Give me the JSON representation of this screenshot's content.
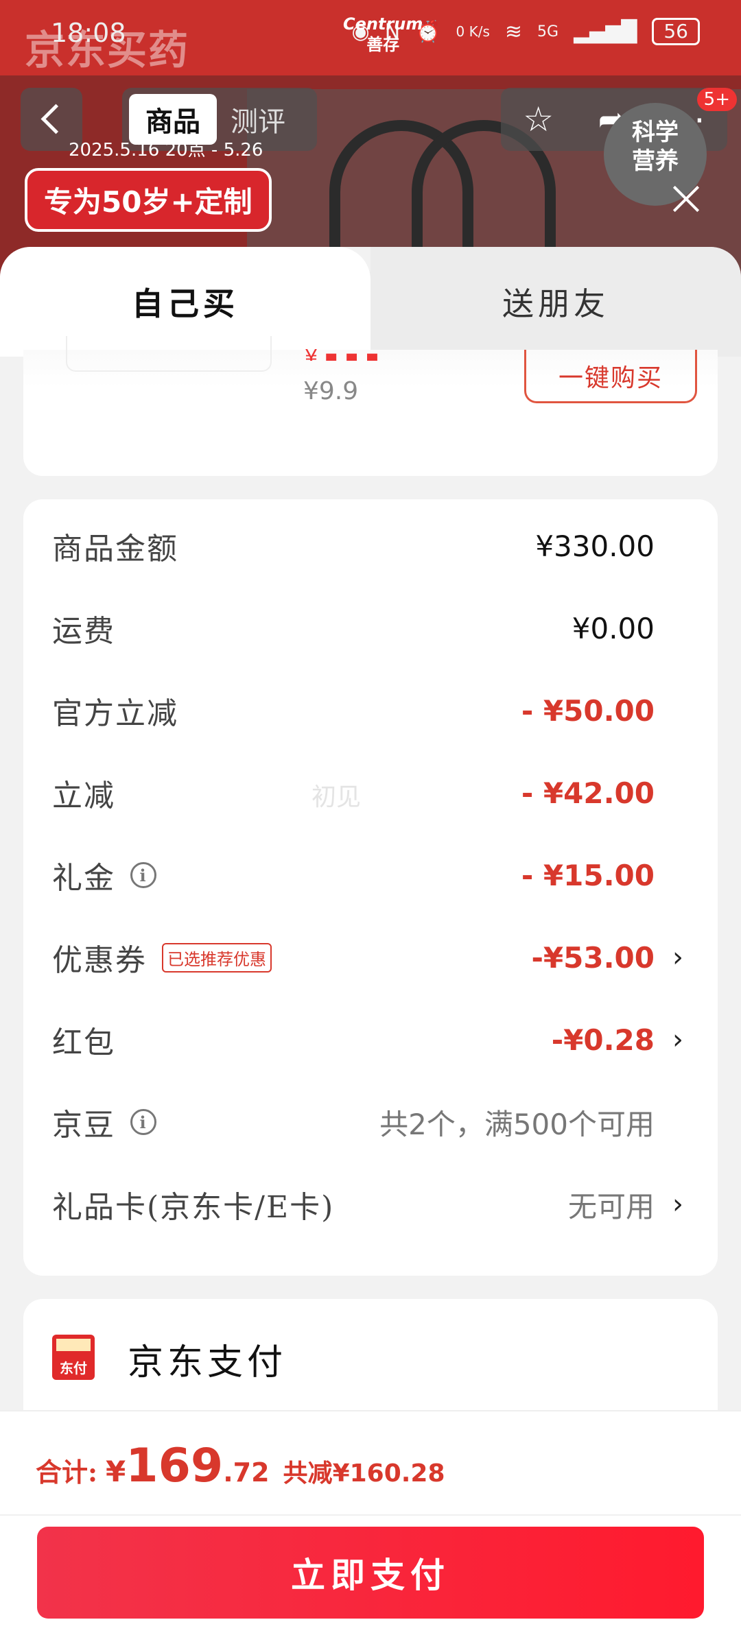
{
  "status_bar": {
    "time": "18:08",
    "net_speed": "0 K/s",
    "network": "5G",
    "battery": "56"
  },
  "background": {
    "logo": "京东买药",
    "brand": [
      "Centrum",
      "善存"
    ],
    "nav_tabs": [
      "商品",
      "测评"
    ],
    "badge": "5+",
    "date": "2025.5.16 20点 - 5.26",
    "promo": "专为50岁+定制",
    "seal": [
      "科学",
      "营养"
    ]
  },
  "sheet": {
    "tabs": {
      "self": "自己买",
      "friend": "送朋友"
    },
    "sku": {
      "price": "¥9.9",
      "buy_button": "一键购买"
    },
    "watermark": "初见",
    "fees": [
      {
        "label": "商品金额",
        "value": "¥330.00",
        "style": "normal",
        "info": false,
        "chevron": false
      },
      {
        "label": "运费",
        "value": "¥0.00",
        "style": "normal",
        "info": false,
        "chevron": false
      },
      {
        "label": "官方立减",
        "value": "- ¥50.00",
        "style": "red",
        "info": false,
        "chevron": false
      },
      {
        "label": "立减",
        "value": "- ¥42.00",
        "style": "red",
        "info": false,
        "chevron": false
      },
      {
        "label": "礼金",
        "value": "- ¥15.00",
        "style": "red",
        "info": true,
        "chevron": false
      },
      {
        "label": "优惠券",
        "value": "-¥53.00",
        "style": "red",
        "info": false,
        "chevron": true,
        "tag": "已选推荐优惠"
      },
      {
        "label": "红包",
        "value": "-¥0.28",
        "style": "red",
        "info": false,
        "chevron": true
      },
      {
        "label": "京豆",
        "value": "共2个，满500个可用",
        "style": "gray",
        "info": true,
        "chevron": false
      },
      {
        "label": "礼品卡(京东卡/E卡)",
        "value": "无可用",
        "style": "gray",
        "info": false,
        "chevron": true
      }
    ],
    "payment": {
      "icon_text": "东付",
      "label": "京东支付"
    }
  },
  "bottom": {
    "total_label": "合计:",
    "yen": "¥",
    "total_int": "169",
    "total_dec": ".72",
    "discount_label": "共减",
    "discount": "¥160.28",
    "pay_button": "立即支付"
  }
}
